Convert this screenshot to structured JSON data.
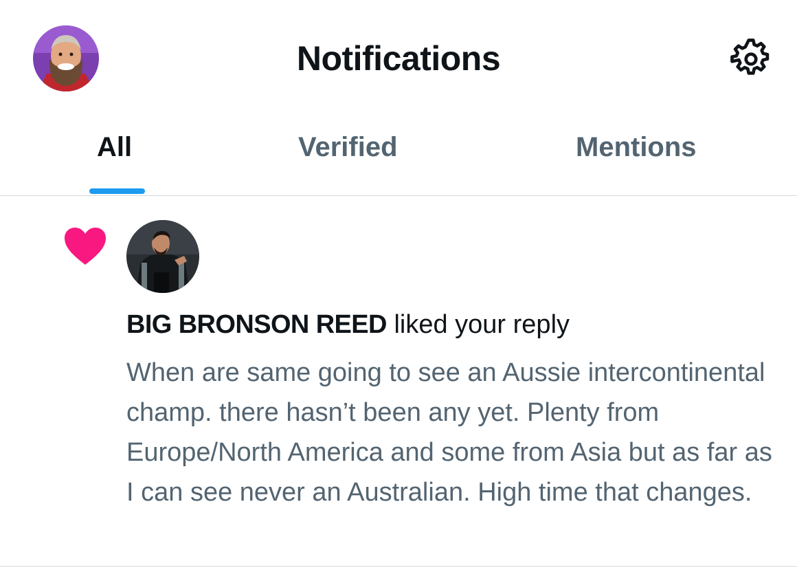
{
  "header": {
    "title": "Notifications",
    "avatar_icon": "user-avatar-bearded-man",
    "settings_icon": "gear-icon"
  },
  "tabs": [
    {
      "label": "All",
      "active": true
    },
    {
      "label": "Verified",
      "active": false
    },
    {
      "label": "Mentions",
      "active": false
    }
  ],
  "notification": {
    "type_icon": "heart-icon",
    "actor_name": "BIG BRONSON REED",
    "action_text": "liked your reply",
    "reply_text": "When are same going to see an Aussie intercontinental champ. there hasn’t been any yet. Plenty from Europe/North America and some from Asia but as far as I can see never an Australian. High time that changes."
  },
  "colors": {
    "accent": "#1d9bf0",
    "heart": "#f91880",
    "primary_text": "#0f1419",
    "secondary_text": "#536471",
    "divider": "#d5d9dc"
  }
}
